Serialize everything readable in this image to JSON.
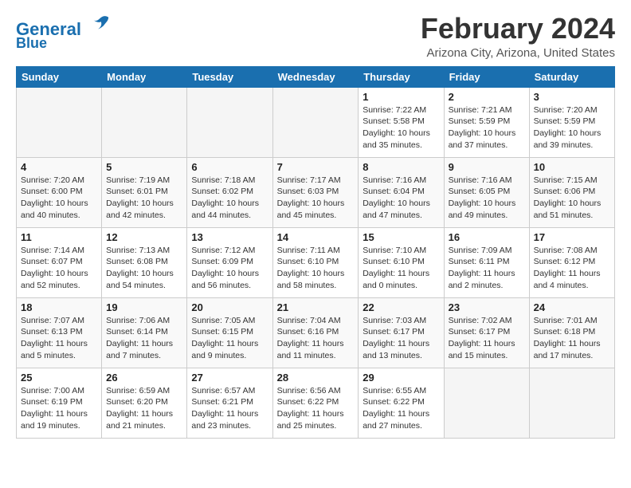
{
  "header": {
    "logo_line1": "General",
    "logo_line2": "Blue",
    "month_title": "February 2024",
    "location": "Arizona City, Arizona, United States"
  },
  "weekdays": [
    "Sunday",
    "Monday",
    "Tuesday",
    "Wednesday",
    "Thursday",
    "Friday",
    "Saturday"
  ],
  "weeks": [
    [
      {
        "day": "",
        "info": ""
      },
      {
        "day": "",
        "info": ""
      },
      {
        "day": "",
        "info": ""
      },
      {
        "day": "",
        "info": ""
      },
      {
        "day": "1",
        "info": "Sunrise: 7:22 AM\nSunset: 5:58 PM\nDaylight: 10 hours\nand 35 minutes."
      },
      {
        "day": "2",
        "info": "Sunrise: 7:21 AM\nSunset: 5:59 PM\nDaylight: 10 hours\nand 37 minutes."
      },
      {
        "day": "3",
        "info": "Sunrise: 7:20 AM\nSunset: 5:59 PM\nDaylight: 10 hours\nand 39 minutes."
      }
    ],
    [
      {
        "day": "4",
        "info": "Sunrise: 7:20 AM\nSunset: 6:00 PM\nDaylight: 10 hours\nand 40 minutes."
      },
      {
        "day": "5",
        "info": "Sunrise: 7:19 AM\nSunset: 6:01 PM\nDaylight: 10 hours\nand 42 minutes."
      },
      {
        "day": "6",
        "info": "Sunrise: 7:18 AM\nSunset: 6:02 PM\nDaylight: 10 hours\nand 44 minutes."
      },
      {
        "day": "7",
        "info": "Sunrise: 7:17 AM\nSunset: 6:03 PM\nDaylight: 10 hours\nand 45 minutes."
      },
      {
        "day": "8",
        "info": "Sunrise: 7:16 AM\nSunset: 6:04 PM\nDaylight: 10 hours\nand 47 minutes."
      },
      {
        "day": "9",
        "info": "Sunrise: 7:16 AM\nSunset: 6:05 PM\nDaylight: 10 hours\nand 49 minutes."
      },
      {
        "day": "10",
        "info": "Sunrise: 7:15 AM\nSunset: 6:06 PM\nDaylight: 10 hours\nand 51 minutes."
      }
    ],
    [
      {
        "day": "11",
        "info": "Sunrise: 7:14 AM\nSunset: 6:07 PM\nDaylight: 10 hours\nand 52 minutes."
      },
      {
        "day": "12",
        "info": "Sunrise: 7:13 AM\nSunset: 6:08 PM\nDaylight: 10 hours\nand 54 minutes."
      },
      {
        "day": "13",
        "info": "Sunrise: 7:12 AM\nSunset: 6:09 PM\nDaylight: 10 hours\nand 56 minutes."
      },
      {
        "day": "14",
        "info": "Sunrise: 7:11 AM\nSunset: 6:10 PM\nDaylight: 10 hours\nand 58 minutes."
      },
      {
        "day": "15",
        "info": "Sunrise: 7:10 AM\nSunset: 6:10 PM\nDaylight: 11 hours\nand 0 minutes."
      },
      {
        "day": "16",
        "info": "Sunrise: 7:09 AM\nSunset: 6:11 PM\nDaylight: 11 hours\nand 2 minutes."
      },
      {
        "day": "17",
        "info": "Sunrise: 7:08 AM\nSunset: 6:12 PM\nDaylight: 11 hours\nand 4 minutes."
      }
    ],
    [
      {
        "day": "18",
        "info": "Sunrise: 7:07 AM\nSunset: 6:13 PM\nDaylight: 11 hours\nand 5 minutes."
      },
      {
        "day": "19",
        "info": "Sunrise: 7:06 AM\nSunset: 6:14 PM\nDaylight: 11 hours\nand 7 minutes."
      },
      {
        "day": "20",
        "info": "Sunrise: 7:05 AM\nSunset: 6:15 PM\nDaylight: 11 hours\nand 9 minutes."
      },
      {
        "day": "21",
        "info": "Sunrise: 7:04 AM\nSunset: 6:16 PM\nDaylight: 11 hours\nand 11 minutes."
      },
      {
        "day": "22",
        "info": "Sunrise: 7:03 AM\nSunset: 6:17 PM\nDaylight: 11 hours\nand 13 minutes."
      },
      {
        "day": "23",
        "info": "Sunrise: 7:02 AM\nSunset: 6:17 PM\nDaylight: 11 hours\nand 15 minutes."
      },
      {
        "day": "24",
        "info": "Sunrise: 7:01 AM\nSunset: 6:18 PM\nDaylight: 11 hours\nand 17 minutes."
      }
    ],
    [
      {
        "day": "25",
        "info": "Sunrise: 7:00 AM\nSunset: 6:19 PM\nDaylight: 11 hours\nand 19 minutes."
      },
      {
        "day": "26",
        "info": "Sunrise: 6:59 AM\nSunset: 6:20 PM\nDaylight: 11 hours\nand 21 minutes."
      },
      {
        "day": "27",
        "info": "Sunrise: 6:57 AM\nSunset: 6:21 PM\nDaylight: 11 hours\nand 23 minutes."
      },
      {
        "day": "28",
        "info": "Sunrise: 6:56 AM\nSunset: 6:22 PM\nDaylight: 11 hours\nand 25 minutes."
      },
      {
        "day": "29",
        "info": "Sunrise: 6:55 AM\nSunset: 6:22 PM\nDaylight: 11 hours\nand 27 minutes."
      },
      {
        "day": "",
        "info": ""
      },
      {
        "day": "",
        "info": ""
      }
    ]
  ]
}
